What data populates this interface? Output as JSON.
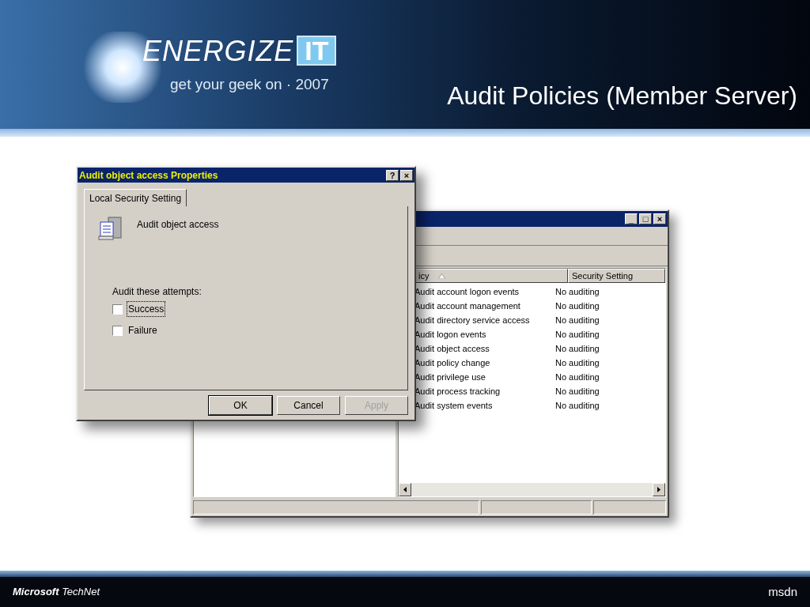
{
  "header": {
    "logo_word": "ENERGIZE",
    "logo_badge": "IT",
    "tagline": "get your geek on · 2007",
    "slide_title": "Audit Policies (Member Server)"
  },
  "back_window": {
    "title_buttons": [
      "_",
      "□",
      "×"
    ],
    "columns": [
      {
        "label": "icy",
        "sorted": true
      },
      {
        "label": "Security Setting",
        "sorted": false
      }
    ],
    "rows": [
      {
        "policy": "Audit account logon events",
        "setting": "No auditing"
      },
      {
        "policy": "Audit account management",
        "setting": "No auditing"
      },
      {
        "policy": "Audit directory service access",
        "setting": "No auditing"
      },
      {
        "policy": "Audit logon events",
        "setting": "No auditing"
      },
      {
        "policy": "Audit object access",
        "setting": "No auditing"
      },
      {
        "policy": "Audit policy change",
        "setting": "No auditing"
      },
      {
        "policy": "Audit privilege use",
        "setting": "No auditing"
      },
      {
        "policy": "Audit process tracking",
        "setting": "No auditing"
      },
      {
        "policy": "Audit system events",
        "setting": "No auditing"
      }
    ]
  },
  "dialog": {
    "title": "Audit object access Properties",
    "title_buttons": [
      "?",
      "×"
    ],
    "tabs": [
      {
        "label": "Local Security Setting",
        "selected": true
      }
    ],
    "policy_name": "Audit object access",
    "group_label": "Audit these attempts:",
    "checkboxes": [
      {
        "label": "Success",
        "checked": false,
        "focused": true
      },
      {
        "label": "Failure",
        "checked": false,
        "focused": false
      }
    ],
    "buttons": [
      {
        "label": "OK",
        "default": true,
        "disabled": false
      },
      {
        "label": "Cancel",
        "default": false,
        "disabled": false
      },
      {
        "label": "Apply",
        "default": false,
        "disabled": true
      }
    ]
  },
  "footer": {
    "brand_bold": "Microsoft",
    "brand_rest": "TechNet",
    "right_logo": "msdn"
  }
}
